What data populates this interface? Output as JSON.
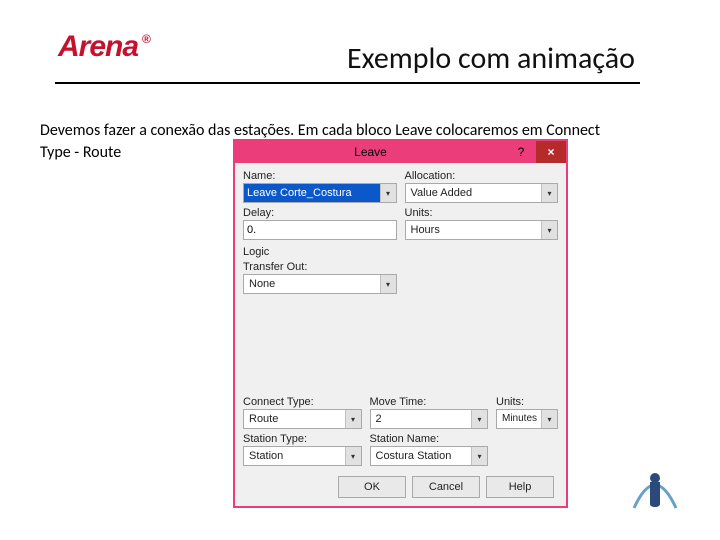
{
  "brand": {
    "name": "Arena",
    "reg": "®"
  },
  "title": "Exemplo com animação",
  "body_line1": "Devemos fazer a conexão das estações. Em cada bloco Leave colocaremos em Connect",
  "body_line2": "Type - Route",
  "dialog": {
    "title": "Leave",
    "help": "?",
    "close": "×",
    "labels": {
      "name": "Name:",
      "allocation": "Allocation:",
      "delay": "Delay:",
      "units": "Units:",
      "logic": "Logic",
      "transfer_out": "Transfer Out:",
      "connect_type": "Connect Type:",
      "move_time": "Move Time:",
      "units2": "Units:",
      "station_type": "Station Type:",
      "station_name": "Station Name:"
    },
    "values": {
      "name": "Leave Corte_Costura",
      "allocation": "Value Added",
      "delay": "0.",
      "units": "Hours",
      "transfer_out": "None",
      "connect_type": "Route",
      "move_time": "2",
      "units2": "Minutes",
      "station_type": "Station",
      "station_name": "Costura Station"
    },
    "buttons": {
      "ok": "OK",
      "cancel": "Cancel",
      "help": "Help"
    }
  }
}
